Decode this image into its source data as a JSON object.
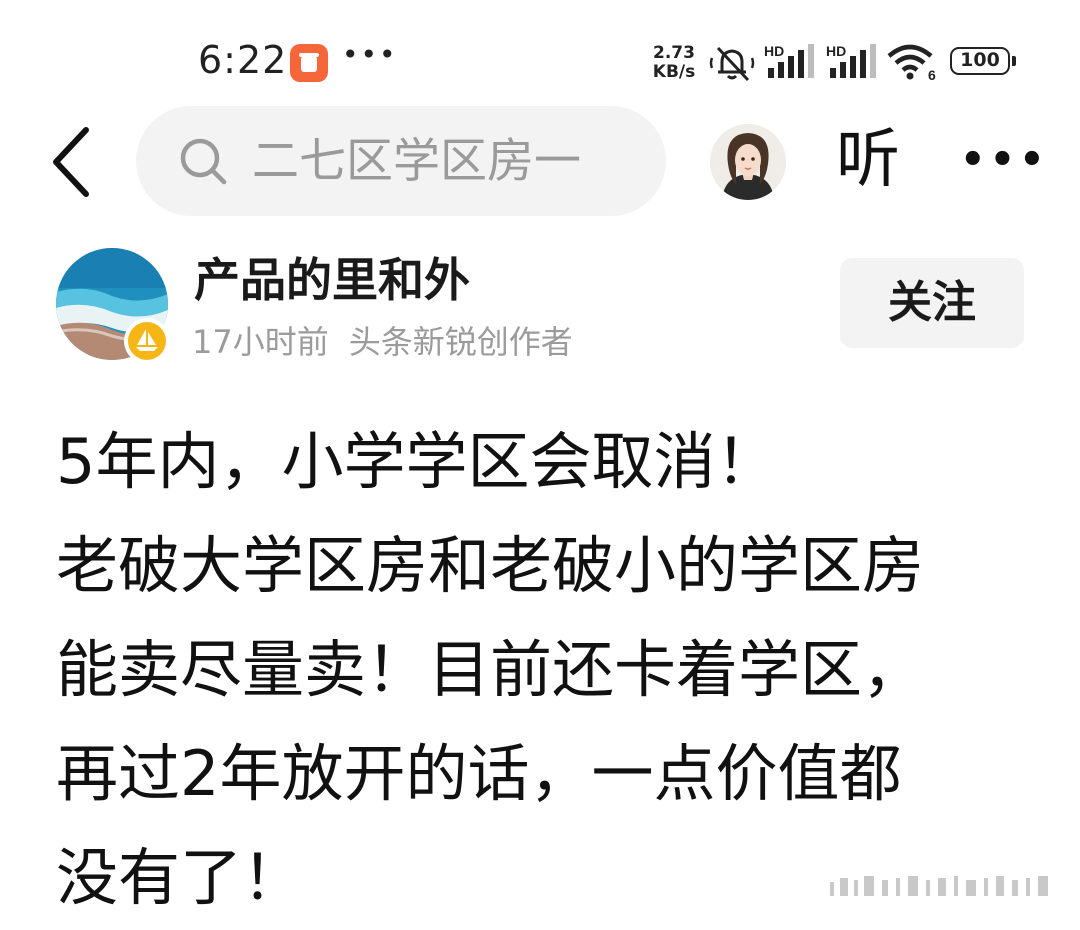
{
  "status_bar": {
    "time": "6:22",
    "more": "•••",
    "net_speed_value": "2.73",
    "net_speed_unit": "KB/s",
    "sim1_label": "HD",
    "sim2_label": "HD",
    "wifi_badge": "6",
    "battery": "100"
  },
  "nav": {
    "search_text": "二七区学区房一",
    "listen_label": "听",
    "more_label": "•••"
  },
  "author": {
    "name": "产品的里和外",
    "time_ago": "17小时前",
    "title": "头条新锐创作者",
    "follow_label": "关注"
  },
  "post": {
    "lines": [
      "5年内，小学学区会取消！",
      "老破大学区房和老破小的学区房",
      "能卖尽量卖！目前还卡着学区，",
      "再过2年放开的话，一点价值都",
      "没有了！"
    ]
  },
  "icons": {
    "back": "chevron-left-icon",
    "search": "search-icon",
    "mute": "bell-off-icon",
    "wifi": "wifi-icon",
    "badge": "sailboat-icon"
  },
  "colors": {
    "notification_app": "#f5673a",
    "badge": "#f6b616",
    "search_bg": "#f3f3f3",
    "meta_text": "#9b9b9b"
  }
}
